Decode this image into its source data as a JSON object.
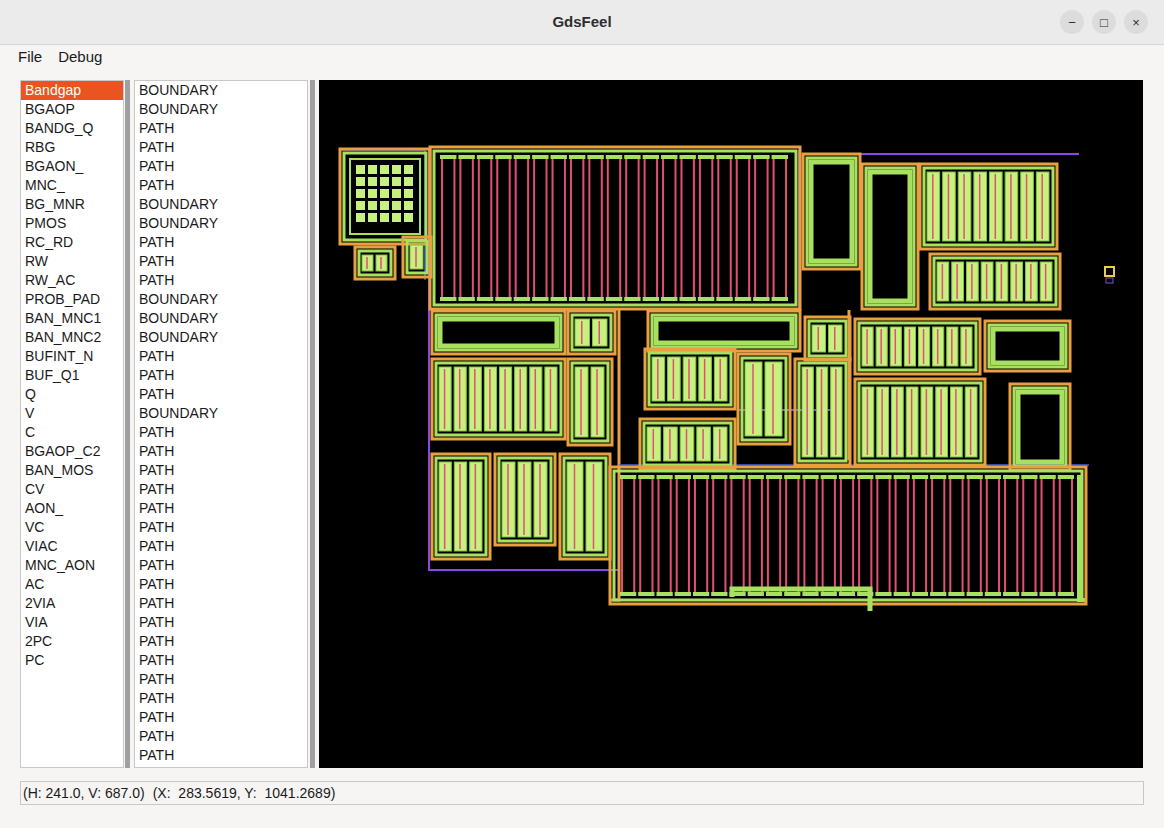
{
  "window": {
    "title": "GdsFeel",
    "controls": [
      "−",
      "□",
      "×"
    ]
  },
  "menu": [
    "File",
    "Debug"
  ],
  "structures": [
    {
      "label": "Bandgap",
      "selected": true
    },
    {
      "label": "BGAOP",
      "selected": false
    },
    {
      "label": "BANDG_Q",
      "selected": false
    },
    {
      "label": "RBG",
      "selected": false
    },
    {
      "label": "BGAON_",
      "selected": false
    },
    {
      "label": "MNC_",
      "selected": false
    },
    {
      "label": "BG_MNR",
      "selected": false
    },
    {
      "label": "PMOS",
      "selected": false
    },
    {
      "label": "RC_RD",
      "selected": false
    },
    {
      "label": "RW",
      "selected": false
    },
    {
      "label": "RW_AC",
      "selected": false
    },
    {
      "label": "PROB_PAD",
      "selected": false
    },
    {
      "label": "BAN_MNC1",
      "selected": false
    },
    {
      "label": "BAN_MNC2",
      "selected": false
    },
    {
      "label": "BUFINT_N",
      "selected": false
    },
    {
      "label": "BUF_Q1",
      "selected": false
    },
    {
      "label": "Q",
      "selected": false
    },
    {
      "label": "V",
      "selected": false
    },
    {
      "label": "C",
      "selected": false
    },
    {
      "label": "BGAOP_C2",
      "selected": false
    },
    {
      "label": "BAN_MOS",
      "selected": false
    },
    {
      "label": "CV",
      "selected": false
    },
    {
      "label": "AON_",
      "selected": false
    },
    {
      "label": "VC",
      "selected": false
    },
    {
      "label": "VIAC",
      "selected": false
    },
    {
      "label": "MNC_AON",
      "selected": false
    },
    {
      "label": "AC",
      "selected": false
    },
    {
      "label": "2VIA",
      "selected": false
    },
    {
      "label": "VIA",
      "selected": false
    },
    {
      "label": "2PC",
      "selected": false
    },
    {
      "label": "PC",
      "selected": false
    }
  ],
  "elements": [
    {
      "label": "BOUNDARY",
      "selected": false
    },
    {
      "label": "BOUNDARY",
      "selected": false
    },
    {
      "label": "PATH",
      "selected": false
    },
    {
      "label": "PATH",
      "selected": false
    },
    {
      "label": "PATH",
      "selected": false
    },
    {
      "label": "PATH",
      "selected": false
    },
    {
      "label": "BOUNDARY",
      "selected": false
    },
    {
      "label": "BOUNDARY",
      "selected": false
    },
    {
      "label": "PATH",
      "selected": false
    },
    {
      "label": "PATH",
      "selected": false
    },
    {
      "label": "PATH",
      "selected": false
    },
    {
      "label": "BOUNDARY",
      "selected": false
    },
    {
      "label": "BOUNDARY",
      "selected": false
    },
    {
      "label": "BOUNDARY",
      "selected": false
    },
    {
      "label": "PATH",
      "selected": false
    },
    {
      "label": "PATH",
      "selected": false
    },
    {
      "label": "PATH",
      "selected": false
    },
    {
      "label": "BOUNDARY",
      "selected": false
    },
    {
      "label": "PATH",
      "selected": false
    },
    {
      "label": "PATH",
      "selected": false
    },
    {
      "label": "PATH",
      "selected": false
    },
    {
      "label": "PATH",
      "selected": false
    },
    {
      "label": "PATH",
      "selected": false
    },
    {
      "label": "PATH",
      "selected": false
    },
    {
      "label": "PATH",
      "selected": false
    },
    {
      "label": "PATH",
      "selected": false
    },
    {
      "label": "PATH",
      "selected": false
    },
    {
      "label": "PATH",
      "selected": false
    },
    {
      "label": "PATH",
      "selected": false
    },
    {
      "label": "PATH",
      "selected": false
    },
    {
      "label": "PATH",
      "selected": false
    },
    {
      "label": "PATH",
      "selected": false
    },
    {
      "label": "PATH",
      "selected": false
    },
    {
      "label": "PATH",
      "selected": false
    },
    {
      "label": "PATH",
      "selected": false
    },
    {
      "label": "PATH",
      "selected": false
    }
  ],
  "status_bar": {
    "screen": "(H: 241.0, V: 687.0)",
    "world": "(X:  283.5619, Y:  1041.2689)"
  }
}
